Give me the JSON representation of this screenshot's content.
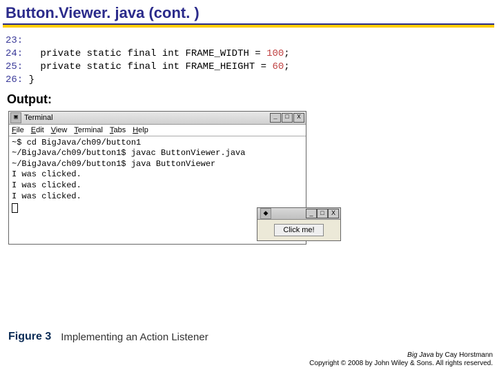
{
  "title": "Button.Viewer. java  (cont. )",
  "code": {
    "ln23": "23:",
    "ln24": "24:",
    "ln25": "25:",
    "ln26": "26:",
    "decl_w_a": "   private static final int FRAME_WIDTH = ",
    "decl_w_n": "100",
    "decl_w_b": ";",
    "decl_h_a": "   private static final int FRAME_HEIGHT = ",
    "decl_h_n": "60",
    "decl_h_b": ";",
    "close": " }"
  },
  "output_label": "Output:",
  "terminal": {
    "title": "Terminal",
    "menu": [
      "File",
      "Edit",
      "View",
      "Terminal",
      "Tabs",
      "Help"
    ],
    "minbtn": "_",
    "maxbtn": "□",
    "closebtn": "X",
    "lines": [
      "~$ cd BigJava/ch09/button1",
      "~/BigJava/ch09/button1$ javac ButtonViewer.java",
      "~/BigJava/ch09/button1$ java ButtonViewer",
      "I was clicked.",
      "I was clicked.",
      "I was clicked."
    ]
  },
  "mini": {
    "button_label": "Click me!"
  },
  "figure": {
    "label": "Figure 3",
    "caption": "Implementing an Action Listener"
  },
  "footer": {
    "line1a": "Big Java",
    "line1b": " by Cay Horstmann",
    "line2": "Copyright © 2008 by John Wiley & Sons.  All rights reserved."
  }
}
